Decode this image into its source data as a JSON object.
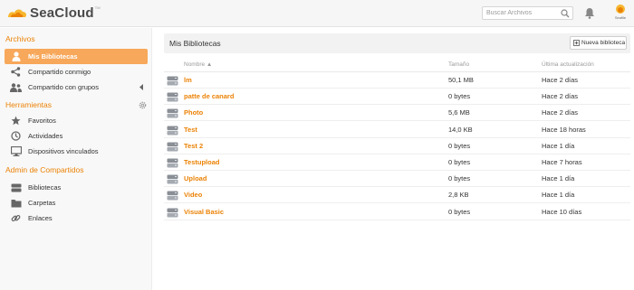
{
  "app": {
    "logo_text": "SeaCloud",
    "logo_tm": "TM",
    "search_placeholder": "Buscar Archivos",
    "avatar_label": "Seafile"
  },
  "sidebar": {
    "files_title": "Archivos",
    "files_items": [
      {
        "label": "Mis Bibliotecas",
        "icon": "user-icon",
        "active": true
      },
      {
        "label": "Compartido conmigo",
        "icon": "share-icon"
      },
      {
        "label": "Compartido con grupos",
        "icon": "group-icon"
      }
    ],
    "tools_title": "Herramientas",
    "tools_items": [
      {
        "label": "Favoritos",
        "icon": "star-icon"
      },
      {
        "label": "Actividades",
        "icon": "clock-icon"
      },
      {
        "label": "Dispositivos vinculados",
        "icon": "monitor-icon"
      }
    ],
    "admin_title": "Admin de Compartidos",
    "admin_items": [
      {
        "label": "Bibliotecas",
        "icon": "drive-icon"
      },
      {
        "label": "Carpetas",
        "icon": "folder-icon"
      },
      {
        "label": "Enlaces",
        "icon": "link-icon"
      }
    ]
  },
  "main": {
    "title": "Mis Bibliotecas",
    "new_library_label": "Nueva biblioteca",
    "columns": {
      "name": "Nombre",
      "size": "Tamaño",
      "updated": "Última actualización"
    },
    "rows": [
      {
        "name": "lm",
        "size": "50,1 MB",
        "updated": "Hace 2 días"
      },
      {
        "name": "patte de canard",
        "size": "0 bytes",
        "updated": "Hace 2 días"
      },
      {
        "name": "Photo",
        "size": "5,6 MB",
        "updated": "Hace 2 días"
      },
      {
        "name": "Test",
        "size": "14,0 KB",
        "updated": "Hace 18 horas"
      },
      {
        "name": "Test 2",
        "size": "0 bytes",
        "updated": "Hace 1 día"
      },
      {
        "name": "Testupload",
        "size": "0 bytes",
        "updated": "Hace 7 horas"
      },
      {
        "name": "Upload",
        "size": "0 bytes",
        "updated": "Hace 1 día"
      },
      {
        "name": "Video",
        "size": "2,8 KB",
        "updated": "Hace 1 día"
      },
      {
        "name": "Visual Basic",
        "size": "0 bytes",
        "updated": "Hace 10 días"
      }
    ]
  },
  "colors": {
    "accent": "#eb8205",
    "active_bg": "#f7a85a"
  }
}
